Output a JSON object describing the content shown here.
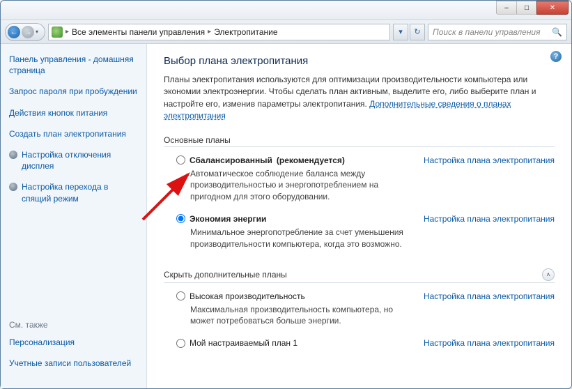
{
  "titlebar": {
    "minimize_icon": "–",
    "maximize_icon": "□",
    "close_icon": "✕"
  },
  "addrbar": {
    "back_icon": "←",
    "fwd_icon": "→",
    "dd_icon": "▾",
    "sep_icon": "▸",
    "crumb_all": "Все элементы панели управления",
    "crumb_page": "Электропитание",
    "refresh_icon": "↻",
    "search_placeholder": "Поиск в панели управления",
    "search_icon": "🔍"
  },
  "sidebar": {
    "items": [
      {
        "label": "Панель управления - домашняя страница"
      },
      {
        "label": "Запрос пароля при пробуждении"
      },
      {
        "label": "Действия кнопок питания"
      },
      {
        "label": "Создать план электропитания"
      },
      {
        "label": "Настройка отключения дисплея",
        "icon": true
      },
      {
        "label": "Настройка перехода в спящий режим",
        "icon": true
      }
    ],
    "see_also_heading": "См. также",
    "see_also": [
      {
        "label": "Персонализация"
      },
      {
        "label": "Учетные записи пользователей"
      }
    ]
  },
  "main": {
    "help_icon": "?",
    "title": "Выбор плана электропитания",
    "intro_text": "Планы электропитания используются для оптимизации производительности компьютера или экономии электроэнергии. Чтобы сделать план активным, выделите его, либо выберите план и настройте его, изменив параметры электропитания. ",
    "intro_link": "Дополнительные сведения о планах электропитания",
    "section_main_title": "Основные планы",
    "section_more_title": "Скрыть дополнительные планы",
    "collapse_icon": "˄",
    "plan_link_label": "Настройка плана электропитания",
    "plans_main": [
      {
        "name": "Сбалансированный",
        "rec": " (рекомендуется)",
        "desc": "Автоматическое соблюдение баланса между производительностью и энергопотреблением на пригодном для этого оборудовании.",
        "selected": false
      },
      {
        "name": "Экономия энергии",
        "rec": "",
        "desc": "Минимальное энергопотребление за счет уменьшения производительности компьютера, когда это возможно.",
        "selected": true
      }
    ],
    "plans_more": [
      {
        "name": "Высокая производительность",
        "rec": "",
        "desc": "Максимальная производительность компьютера, но может потребоваться больше энергии.",
        "selected": false
      },
      {
        "name": "Мой настраиваемый план 1",
        "rec": "",
        "desc": "",
        "selected": false
      }
    ]
  }
}
